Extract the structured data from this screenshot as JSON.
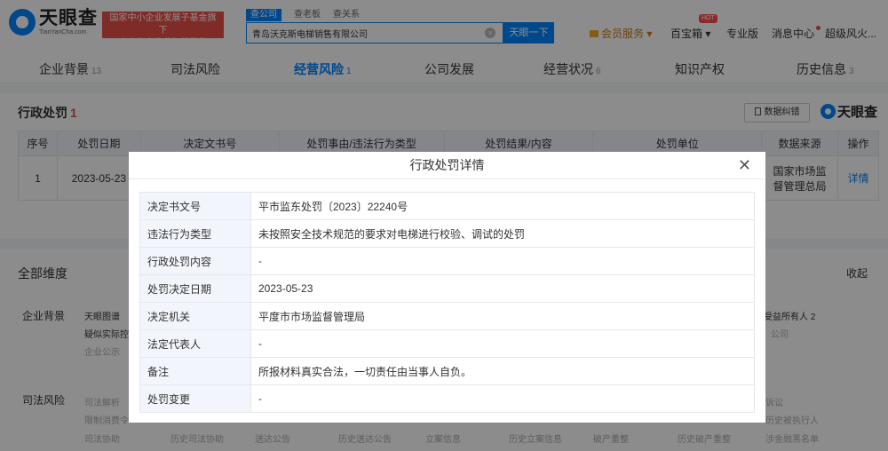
{
  "header": {
    "logo_cn": "天眼查",
    "logo_en": "TianYanCha.com",
    "gov_badge_line1": "国家中小企业发展子基金旗下",
    "gov_badge_line2": "官方备案企业征信机构",
    "search_tabs": [
      "查公司",
      "查老板",
      "查关系"
    ],
    "search_value": "青岛沃克斯电梯销售有限公司",
    "search_button": "天眼一下",
    "vip": "会员服务",
    "baibaoxiang": "百宝箱",
    "hot": "HOT",
    "professional": "专业版",
    "messages": "消息中心",
    "user": "超级风火..."
  },
  "nav_tabs": [
    {
      "label": "企业背景",
      "count": "13"
    },
    {
      "label": "司法风险",
      "count": ""
    },
    {
      "label": "经营风险",
      "count": "1"
    },
    {
      "label": "公司发展",
      "count": ""
    },
    {
      "label": "经营状况",
      "count": "6"
    },
    {
      "label": "知识产权",
      "count": ""
    },
    {
      "label": "历史信息",
      "count": "3"
    }
  ],
  "section": {
    "title": "行政处罚",
    "count": "1",
    "export_label": "数据纠错",
    "brand": "天眼查"
  },
  "table": {
    "headers": [
      "序号",
      "处罚日期",
      "决定文书号",
      "处罚事由/违法行为类型",
      "处罚结果/内容",
      "处罚单位",
      "数据来源",
      "操作"
    ],
    "row": {
      "index": "1",
      "date": "2023-05-23",
      "source_line1": "国家市场监",
      "source_line2": "督管理总局",
      "action": "详情"
    }
  },
  "dimensions": {
    "title": "全部维度",
    "collapse": "收起",
    "groups": [
      {
        "label": "企业背景",
        "items": [
          "天眼图谱",
          "疑似实际控",
          "企业公示"
        ],
        "right_items": [
          "受益所有人 2",
          "公司"
        ]
      },
      {
        "label": "司法风险",
        "items": [
          "司法解析",
          "限制消费令",
          "司法协助",
          "历史司法协助",
          "送达公告",
          "历史送达公告",
          "立案信息",
          "历史立案信息",
          "破产重整",
          "历史破产重整",
          "诉讼",
          "历史被执行人",
          "涉金融黑名单"
        ]
      }
    ]
  },
  "modal": {
    "title": "行政处罚详情",
    "rows": [
      {
        "key": "决定书文号",
        "value": "平市监东处罚〔2023〕22240号"
      },
      {
        "key": "违法行为类型",
        "value": "未按照安全技术规范的要求对电梯进行校验、调试的处罚"
      },
      {
        "key": "行政处罚内容",
        "value": "-"
      },
      {
        "key": "处罚决定日期",
        "value": "2023-05-23"
      },
      {
        "key": "决定机关",
        "value": "平度市市场监督管理局"
      },
      {
        "key": "法定代表人",
        "value": "-"
      },
      {
        "key": "备注",
        "value": "所报材料真实合法，一切责任由当事人自负。"
      },
      {
        "key": "处罚变更",
        "value": "-"
      }
    ]
  }
}
